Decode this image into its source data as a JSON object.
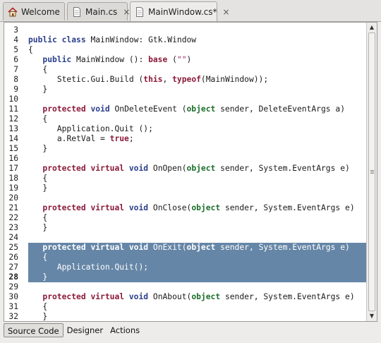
{
  "tabs": [
    {
      "label": "Welcome",
      "icon": "home-icon",
      "active": false
    },
    {
      "label": "Main.cs",
      "icon": "document-icon",
      "active": false
    },
    {
      "label": "MainWindow.cs*",
      "icon": "document-icon",
      "active": true
    }
  ],
  "close_glyph": "×",
  "code": {
    "lines": [
      {
        "n": "3",
        "text": ""
      },
      {
        "n": "4",
        "text": "public class MainWindow: Gtk.Window"
      },
      {
        "n": "5",
        "text": "{"
      },
      {
        "n": "6",
        "text": "   public MainWindow (): base (\"\")"
      },
      {
        "n": "7",
        "text": "   {"
      },
      {
        "n": "8",
        "text": "      Stetic.Gui.Build (this, typeof(MainWindow));"
      },
      {
        "n": "9",
        "text": "   }"
      },
      {
        "n": "10",
        "text": ""
      },
      {
        "n": "11",
        "text": "   protected void OnDeleteEvent (object sender, DeleteEventArgs a)"
      },
      {
        "n": "12",
        "text": "   {"
      },
      {
        "n": "13",
        "text": "      Application.Quit ();"
      },
      {
        "n": "14",
        "text": "      a.RetVal = true;"
      },
      {
        "n": "15",
        "text": "   }"
      },
      {
        "n": "16",
        "text": ""
      },
      {
        "n": "17",
        "text": "   protected virtual void OnOpen(object sender, System.EventArgs e)"
      },
      {
        "n": "18",
        "text": "   {"
      },
      {
        "n": "19",
        "text": "   }"
      },
      {
        "n": "20",
        "text": ""
      },
      {
        "n": "21",
        "text": "   protected virtual void OnClose(object sender, System.EventArgs e)"
      },
      {
        "n": "22",
        "text": "   {"
      },
      {
        "n": "23",
        "text": "   }"
      },
      {
        "n": "24",
        "text": ""
      },
      {
        "n": "25",
        "text": "   protected virtual void OnExit(object sender, System.EventArgs e)",
        "selected": true
      },
      {
        "n": "26",
        "text": "   {",
        "selected": true
      },
      {
        "n": "27",
        "text": "      Application.Quit();",
        "selected": true
      },
      {
        "n": "28",
        "text": "   }",
        "selected": true
      },
      {
        "n": "29",
        "text": ""
      },
      {
        "n": "30",
        "text": "   protected virtual void OnAbout(object sender, System.EventArgs e)"
      },
      {
        "n": "31",
        "text": "   {"
      },
      {
        "n": "32",
        "text": "   }"
      }
    ],
    "keywords_blue": [
      "public",
      "class",
      "void"
    ],
    "keywords_red": [
      "protected",
      "virtual",
      "base",
      "this",
      "typeof",
      "true"
    ],
    "keywords_green": [
      "object"
    ]
  },
  "bottom_tabs": [
    {
      "label": "Source Code",
      "active": true
    },
    {
      "label": "Designer",
      "active": false
    },
    {
      "label": "Actions",
      "active": false
    }
  ],
  "colors": {
    "selection": "#6686a7",
    "keyword_blue": "#2b3f8c",
    "keyword_red": "#8b1a3a",
    "keyword_green": "#1c6e2a",
    "string": "#a0246a"
  }
}
